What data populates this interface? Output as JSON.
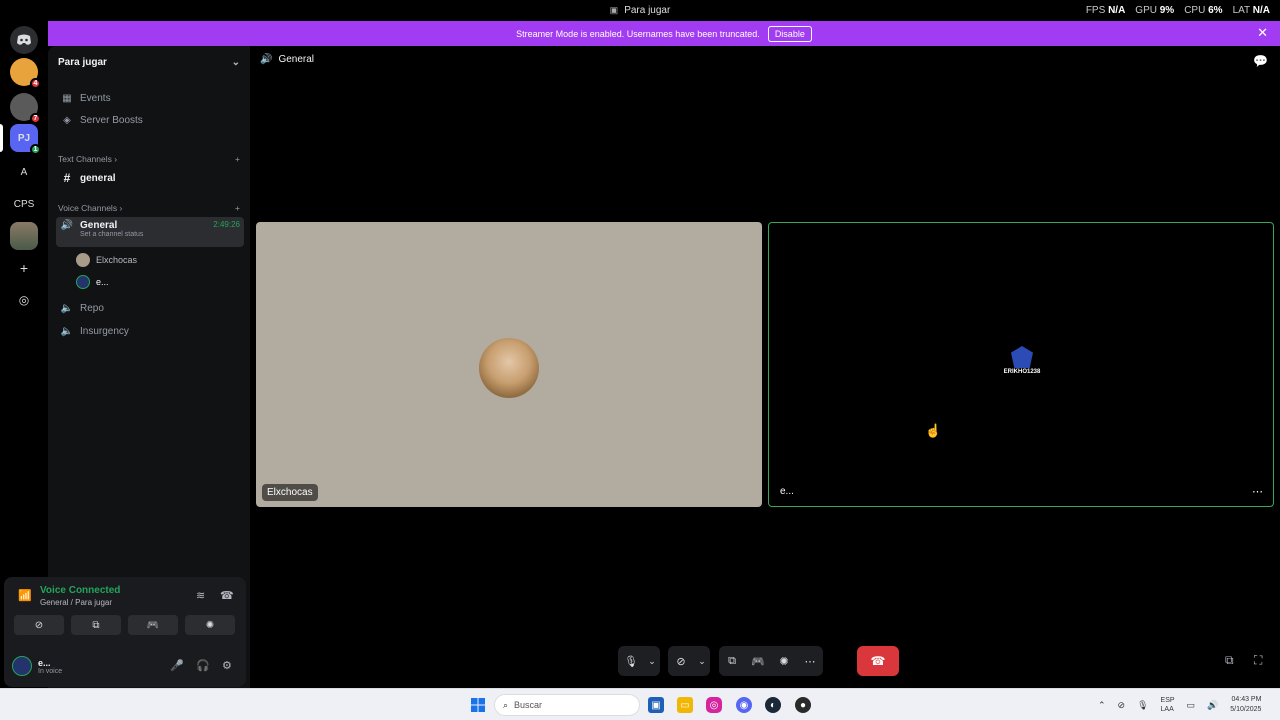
{
  "window": {
    "title": "Para jugar",
    "fps_label": "FPS",
    "fps": "N/A",
    "gpu_label": "GPU",
    "gpu": "9%",
    "cpu_label": "CPU",
    "cpu": "6%",
    "lat_label": "LAT",
    "lat": "N/A"
  },
  "banner": {
    "text": "Streamer Mode is enabled. Usernames have been truncated.",
    "button": "Disable",
    "color": "#a23cf2"
  },
  "rail": {
    "items": [
      {
        "label": "",
        "icon": "discord-icon"
      },
      {
        "label": "",
        "badge": "4"
      },
      {
        "label": "",
        "badge": "7"
      },
      {
        "label": "PJ",
        "badge": "1"
      },
      {
        "label": "A"
      },
      {
        "label": "CPS"
      },
      {
        "label": "",
        "icon": "server-image"
      },
      {
        "label": "+",
        "icon": "add-server-icon"
      },
      {
        "label": "",
        "icon": "discover-icon"
      }
    ]
  },
  "sidebar": {
    "server_name": "Para jugar",
    "events": "Events",
    "boosts": "Server Boosts",
    "text_category": "Text Channels",
    "text_channel": "general",
    "voice_category": "Voice Channels",
    "voice_channels": [
      {
        "name": "General",
        "status_hint": "Set a channel status",
        "timer": "2:49:26"
      },
      {
        "name": "Repo"
      },
      {
        "name": "Insurgency"
      }
    ],
    "members": [
      "Elxchocas",
      "e..."
    ]
  },
  "voice_panel": {
    "status": "Voice Connected",
    "location": "General / Para jugar",
    "user": "e...",
    "user_status": "In voice"
  },
  "main": {
    "channel": "General",
    "tiles": [
      {
        "name": "Elxchocas"
      },
      {
        "name": "e...",
        "avatar_text": "ERIKHO1238"
      }
    ]
  },
  "taskbar": {
    "search_placeholder": "Buscar",
    "lang": "ESP",
    "lang_sub": "LAA",
    "time": "04:43 PM",
    "date": "5/10/2025"
  },
  "colors": {
    "accent_green": "#23a55a",
    "hangup_red": "#da373c"
  }
}
